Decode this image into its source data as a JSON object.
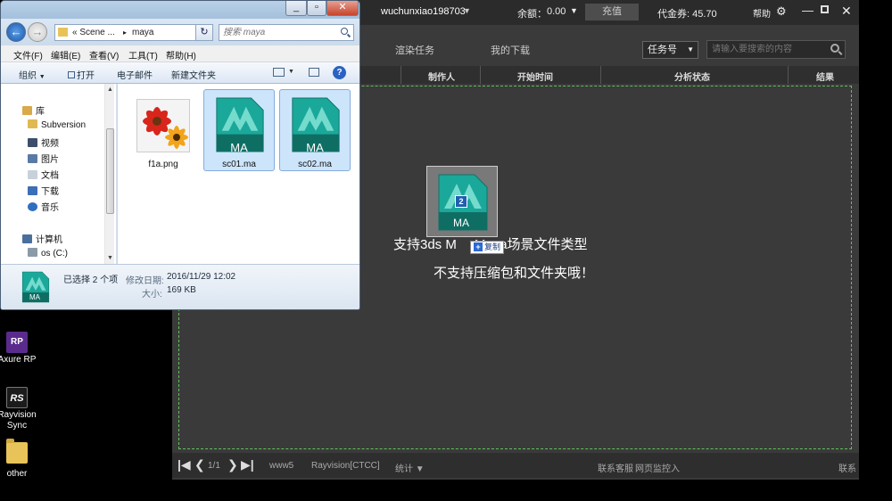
{
  "desktop": {
    "icons": [
      {
        "label": "Axure RP",
        "glyph": "RP"
      },
      {
        "label": "Rayvision Sync",
        "glyph": "RS"
      },
      {
        "label": "other"
      }
    ]
  },
  "app": {
    "username": "wuchunxiao198703",
    "balance_label": "余额：",
    "balance_value": "0.00",
    "recharge_label": "充值",
    "coupon": "代金券: 45.70",
    "help_label": "帮助",
    "tabs": [
      "渲染任务",
      "我的下载"
    ],
    "filter_select": "任务号",
    "search_placeholder": "请输入要搜索的内容",
    "columns": [
      "制作人",
      "开始时间",
      "分析状态",
      "结果"
    ],
    "drop_line1": "支持3ds M",
    "drop_line1_end": "Maya场景文件类型",
    "drop_line2": "不支持压缩包和文件夹哦！",
    "drag_count": "2",
    "drag_label": "MA",
    "copy_tip": "复制",
    "footer": {
      "page": "1/1",
      "server": "www5",
      "region": "Rayvision[CTCC]",
      "stats": "统计",
      "contact": "联系客服",
      "monitor": "网页监控入",
      "contact2": "联系"
    },
    "colors": {
      "drop_border": "#5fc35a",
      "bg": "#3a3a3a"
    }
  },
  "explorer": {
    "breadcrumb": [
      "« Scene ...",
      "maya"
    ],
    "search_placeholder": "搜索 maya",
    "menu": [
      "文件(F)",
      "编辑(E)",
      "查看(V)",
      "工具(T)",
      "帮助(H)"
    ],
    "toolbar": {
      "organize": "组织",
      "open": "打开",
      "email": "电子邮件",
      "new_folder": "新建文件夹"
    },
    "nav": [
      {
        "label": "库",
        "icon": "library-icon"
      },
      {
        "label": "Subversion",
        "icon": "subversion-icon"
      },
      {
        "label": "视频",
        "icon": "video-icon"
      },
      {
        "label": "图片",
        "icon": "picture-icon"
      },
      {
        "label": "文档",
        "icon": "document-icon"
      },
      {
        "label": "下载",
        "icon": "download-icon"
      },
      {
        "label": "音乐",
        "icon": "music-icon"
      },
      {
        "label": "计算机",
        "icon": "computer-icon"
      },
      {
        "label": "os (C:)",
        "icon": "drive-icon"
      }
    ],
    "files": [
      {
        "name": "f1a.png",
        "selected": false
      },
      {
        "name": "sc01.ma",
        "selected": true,
        "badge": "MA"
      },
      {
        "name": "sc02.ma",
        "selected": true,
        "badge": "MA"
      }
    ],
    "details": {
      "selected": "已选择 2 个项",
      "modified_label": "修改日期:",
      "modified": "2016/11/29 12:02",
      "size_label": "大小:",
      "size": "169 KB",
      "badge": "MA"
    }
  }
}
